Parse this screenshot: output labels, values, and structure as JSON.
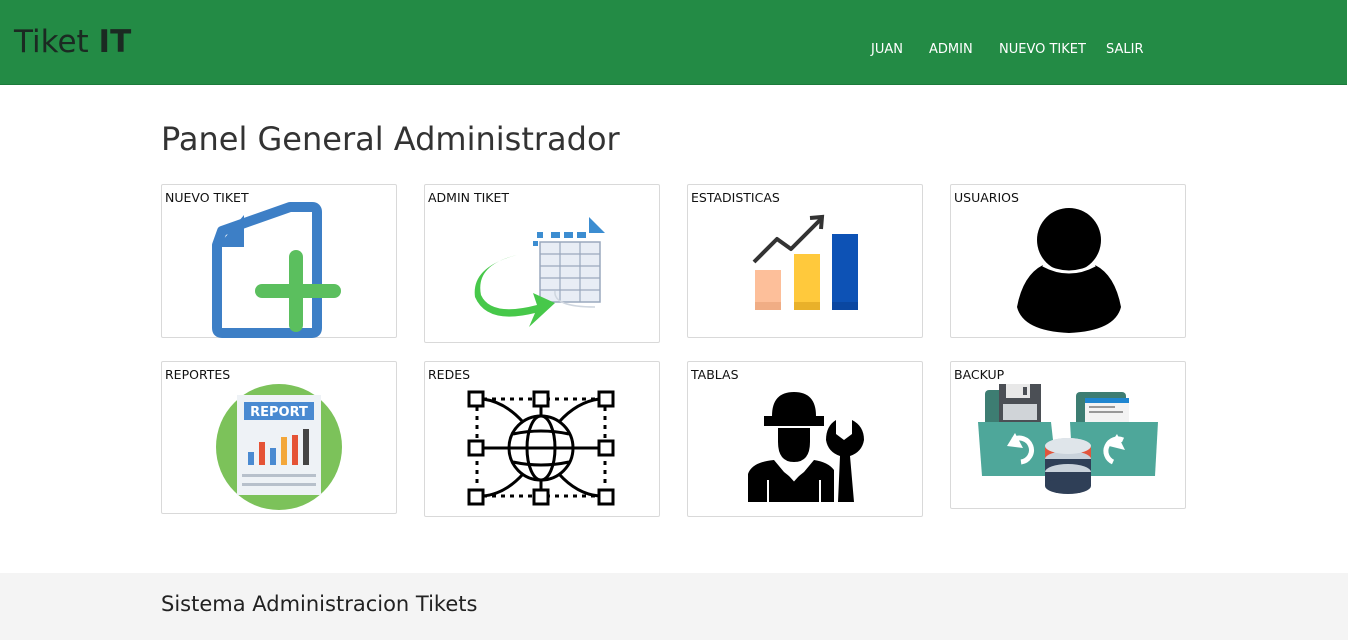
{
  "header": {
    "brand_light": "Tiket ",
    "brand_bold": "IT",
    "nav": [
      "JUAN",
      "ADMIN",
      "NUEVO TIKET",
      "SALIR"
    ],
    "bar_color": "#238b45"
  },
  "main": {
    "title": "Panel General Administrador",
    "cards": [
      {
        "label": "NUEVO TIKET",
        "icon": "new-document-plus-icon"
      },
      {
        "label": "ADMIN TIKET",
        "icon": "table-arrow-icon"
      },
      {
        "label": "ESTADISTICAS",
        "icon": "bar-chart-trend-icon"
      },
      {
        "label": "USUARIOS",
        "icon": "user-silhouette-icon"
      },
      {
        "label": "REPORTES",
        "icon": "report-icon"
      },
      {
        "label": "REDES",
        "icon": "network-globe-icon"
      },
      {
        "label": "TABLAS",
        "icon": "technician-wrench-icon"
      },
      {
        "label": "BACKUP",
        "icon": "backup-database-icon"
      }
    ]
  },
  "footer": {
    "text": "Sistema Administracion Tikets"
  }
}
